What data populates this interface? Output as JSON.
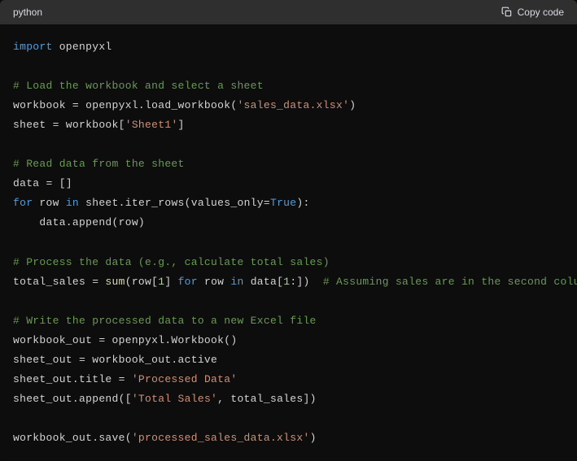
{
  "header": {
    "language": "python",
    "copy_label": "Copy code"
  },
  "code": {
    "tokens": [
      [
        {
          "t": "kw",
          "v": "import"
        },
        {
          "t": "txt",
          "v": " openpyxl"
        }
      ],
      [],
      [
        {
          "t": "com",
          "v": "# Load the workbook and select a sheet"
        }
      ],
      [
        {
          "t": "txt",
          "v": "workbook = openpyxl.load_workbook("
        },
        {
          "t": "str",
          "v": "'sales_data.xlsx'"
        },
        {
          "t": "txt",
          "v": ")"
        }
      ],
      [
        {
          "t": "txt",
          "v": "sheet = workbook["
        },
        {
          "t": "str",
          "v": "'Sheet1'"
        },
        {
          "t": "txt",
          "v": "]"
        }
      ],
      [],
      [
        {
          "t": "com",
          "v": "# Read data from the sheet"
        }
      ],
      [
        {
          "t": "txt",
          "v": "data = []"
        }
      ],
      [
        {
          "t": "kw",
          "v": "for"
        },
        {
          "t": "txt",
          "v": " row "
        },
        {
          "t": "kw",
          "v": "in"
        },
        {
          "t": "txt",
          "v": " sheet.iter_rows(values_only="
        },
        {
          "t": "bool",
          "v": "True"
        },
        {
          "t": "txt",
          "v": "):"
        }
      ],
      [
        {
          "t": "txt",
          "v": "    data.append(row)"
        }
      ],
      [],
      [
        {
          "t": "com",
          "v": "# Process the data (e.g., calculate total sales)"
        }
      ],
      [
        {
          "t": "txt",
          "v": "total_sales = "
        },
        {
          "t": "fn",
          "v": "sum"
        },
        {
          "t": "txt",
          "v": "(row["
        },
        {
          "t": "num",
          "v": "1"
        },
        {
          "t": "txt",
          "v": "] "
        },
        {
          "t": "kw",
          "v": "for"
        },
        {
          "t": "txt",
          "v": " row "
        },
        {
          "t": "kw",
          "v": "in"
        },
        {
          "t": "txt",
          "v": " data["
        },
        {
          "t": "num",
          "v": "1"
        },
        {
          "t": "txt",
          "v": ":])  "
        },
        {
          "t": "com",
          "v": "# Assuming sales are in the second column"
        }
      ],
      [],
      [
        {
          "t": "com",
          "v": "# Write the processed data to a new Excel file"
        }
      ],
      [
        {
          "t": "txt",
          "v": "workbook_out = openpyxl.Workbook()"
        }
      ],
      [
        {
          "t": "txt",
          "v": "sheet_out = workbook_out.active"
        }
      ],
      [
        {
          "t": "txt",
          "v": "sheet_out.title = "
        },
        {
          "t": "str",
          "v": "'Processed Data'"
        }
      ],
      [
        {
          "t": "txt",
          "v": "sheet_out.append(["
        },
        {
          "t": "str",
          "v": "'Total Sales'"
        },
        {
          "t": "txt",
          "v": ", total_sales])"
        }
      ],
      [],
      [
        {
          "t": "txt",
          "v": "workbook_out.save("
        },
        {
          "t": "str",
          "v": "'processed_sales_data.xlsx'"
        },
        {
          "t": "txt",
          "v": ")"
        }
      ]
    ]
  }
}
